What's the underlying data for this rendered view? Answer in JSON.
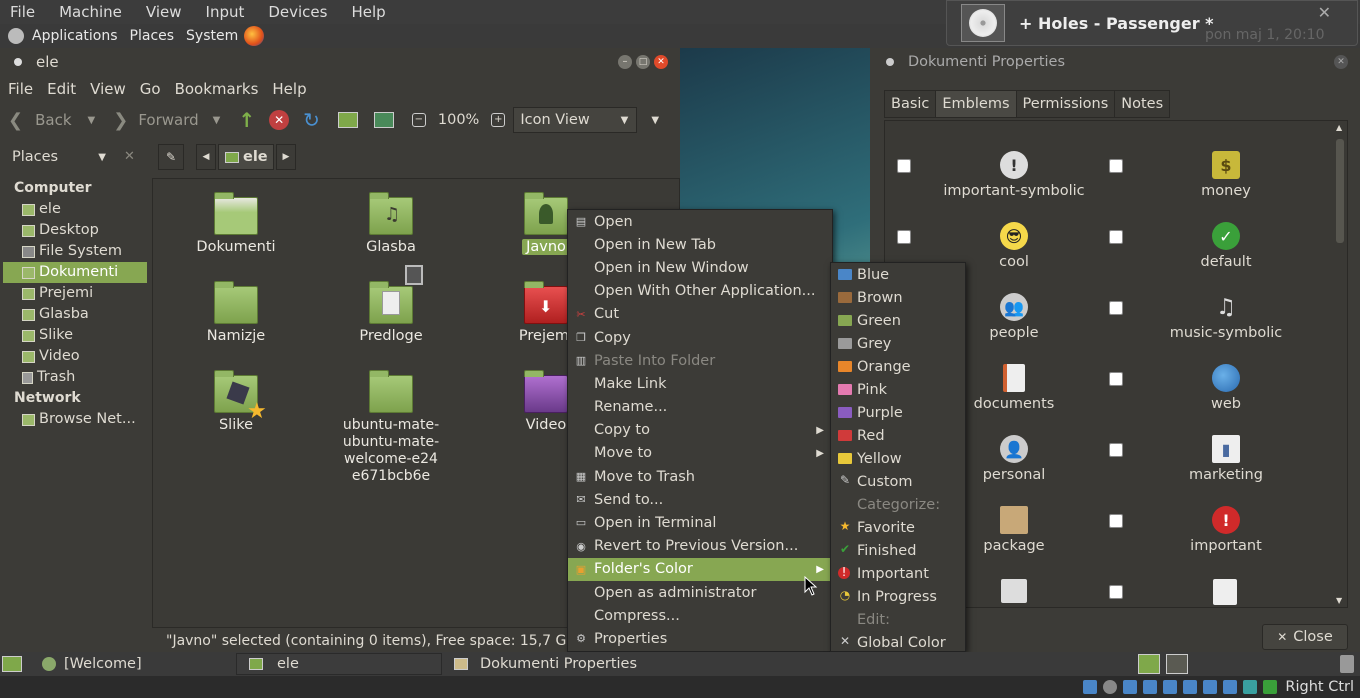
{
  "vm_menu": [
    "File",
    "Machine",
    "View",
    "Input",
    "Devices",
    "Help"
  ],
  "panel": {
    "applications": "Applications",
    "places": "Places",
    "system": "System"
  },
  "notification": {
    "title": "+ Holes - Passenger *",
    "clock": "pon maj  1, 20:10"
  },
  "fm": {
    "title": "ele",
    "menu": [
      "File",
      "Edit",
      "View",
      "Go",
      "Bookmarks",
      "Help"
    ],
    "toolbar": {
      "back": "Back",
      "forward": "Forward",
      "zoom": "100%",
      "view_mode": "Icon View"
    },
    "places_label": "Places",
    "path_button": "ele",
    "sidebar": {
      "computer_header": "Computer",
      "computer_items": [
        "ele",
        "Desktop",
        "File System",
        "Dokumenti",
        "Prejemi",
        "Glasba",
        "Slike",
        "Video",
        "Trash"
      ],
      "network_header": "Network",
      "network_items": [
        "Browse Net..."
      ]
    },
    "items": [
      "Dokumenti",
      "Glasba",
      "Javno",
      "Namizje",
      "Predloge",
      "Prejemi",
      "Slike",
      "ubuntu-mate-ubuntu-mate-welcome-e24e671bcb6e",
      "Video"
    ],
    "status": "\"Javno\" selected (containing 0 items), Free space: 15,7 GB"
  },
  "context_menu": [
    {
      "label": "Open",
      "icon": "open-icon"
    },
    {
      "label": "Open in New Tab",
      "icon": ""
    },
    {
      "label": "Open in New Window",
      "icon": ""
    },
    {
      "label": "Open With Other Application...",
      "icon": ""
    },
    {
      "label": "Cut",
      "icon": "scissors-icon"
    },
    {
      "label": "Copy",
      "icon": "copy-icon"
    },
    {
      "label": "Paste Into Folder",
      "icon": "paste-icon",
      "disabled": true
    },
    {
      "label": "Make Link",
      "icon": ""
    },
    {
      "label": "Rename...",
      "icon": ""
    },
    {
      "label": "Copy to",
      "icon": "",
      "submenu": true
    },
    {
      "label": "Move to",
      "icon": "",
      "submenu": true
    },
    {
      "label": "Move to Trash",
      "icon": "trash-icon"
    },
    {
      "label": "Send to...",
      "icon": "send-icon"
    },
    {
      "label": "Open in Terminal",
      "icon": "terminal-icon"
    },
    {
      "label": "Revert to Previous Version...",
      "icon": "revert-icon"
    },
    {
      "label": "Folder's Color",
      "icon": "palette-icon",
      "submenu": true,
      "highlighted": true
    },
    {
      "label": "Open as administrator",
      "icon": ""
    },
    {
      "label": "Compress...",
      "icon": ""
    },
    {
      "label": "Properties",
      "icon": "gear-icon"
    }
  ],
  "color_submenu": [
    {
      "label": "Blue",
      "color": "#4a86c8"
    },
    {
      "label": "Brown",
      "color": "#9a6a3c"
    },
    {
      "label": "Green",
      "color": "#87a752"
    },
    {
      "label": "Grey",
      "color": "#9a9a9a"
    },
    {
      "label": "Orange",
      "color": "#e8862a"
    },
    {
      "label": "Pink",
      "color": "#e47ab0"
    },
    {
      "label": "Purple",
      "color": "#8a5cc0"
    },
    {
      "label": "Red",
      "color": "#d03a3a"
    },
    {
      "label": "Yellow",
      "color": "#e8c83a"
    },
    {
      "label": "Custom",
      "color": "pencil"
    },
    {
      "label": "Categorize:",
      "disabled": true
    },
    {
      "label": "Favorite",
      "color": "star"
    },
    {
      "label": "Finished",
      "color": "check"
    },
    {
      "label": "Important",
      "color": "exclaim"
    },
    {
      "label": "In Progress",
      "color": "progress"
    },
    {
      "label": "Edit:",
      "disabled": true
    },
    {
      "label": "Global Color",
      "color": "tools"
    }
  ],
  "props": {
    "title": "Dokumenti Properties",
    "tabs": [
      "Basic",
      "Emblems",
      "Permissions",
      "Notes"
    ],
    "emblems_left": [
      "important-symbolic",
      "cool",
      "people",
      "documents",
      "personal",
      "package"
    ],
    "emblems_right": [
      "money",
      "default",
      "music-symbolic",
      "web",
      "marketing",
      "important"
    ],
    "close": "Close"
  },
  "taskbar": {
    "welcome": "[Welcome]",
    "ele": "ele",
    "props": "Dokumenti Properties"
  },
  "host_key": "Right Ctrl"
}
